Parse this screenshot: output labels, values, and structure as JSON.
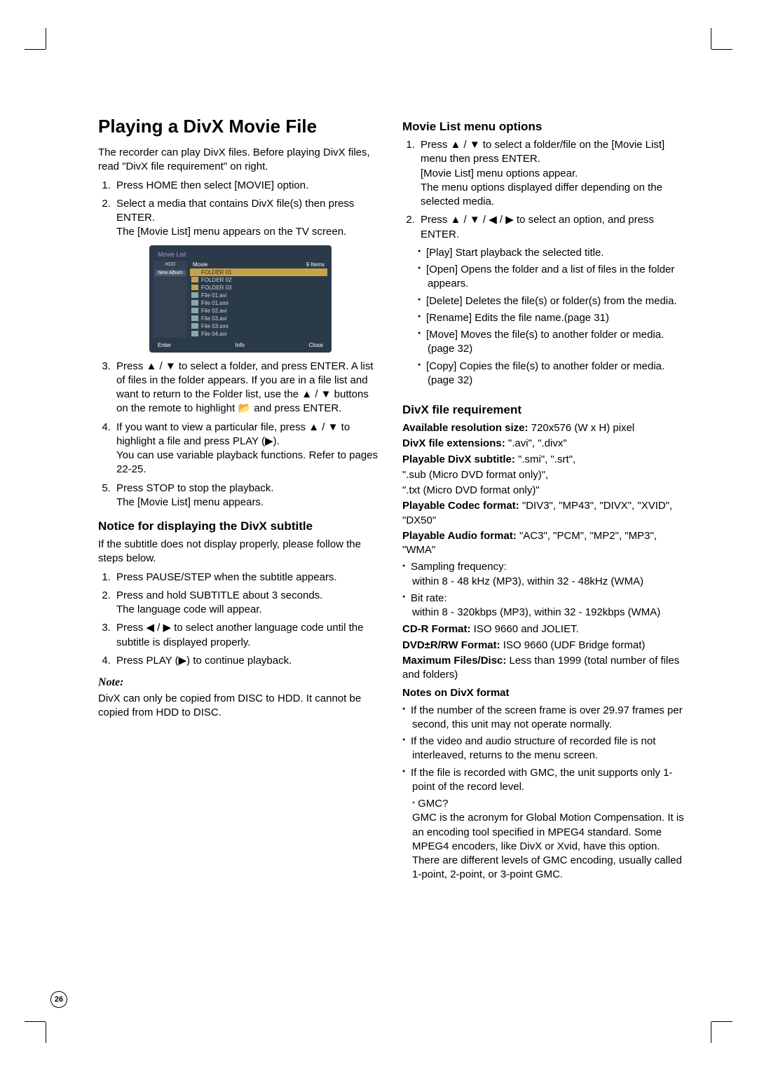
{
  "page_number": "26",
  "left": {
    "h1": "Playing a DivX Movie File",
    "intro": "The recorder can play DivX files. Before playing DivX files, read \"DivX file requirement\" on right.",
    "steps": [
      "Press HOME then select [MOVIE] option.",
      "Select a media that contains DivX file(s) then press ENTER.\nThe [Movie List] menu appears on the TV screen.",
      "Press ▲ / ▼ to select a folder, and press ENTER. A list of files in the folder appears. If you are in a file list and want to return to the Folder list, use the ▲ / ▼ buttons on the remote to highlight 📂 and press ENTER.",
      "If you want to view a particular file, press ▲ / ▼ to highlight a file and press PLAY (▶).\nYou can use variable playback functions. Refer to pages 22-25.",
      "Press STOP to stop the playback.\nThe [Movie List] menu appears."
    ],
    "h2_subtitle": "Notice for displaying the DivX subtitle",
    "subtitle_intro": "If the subtitle does not display properly, please follow the steps below.",
    "subtitle_steps": [
      "Press PAUSE/STEP when the subtitle appears.",
      "Press and hold SUBTITLE about 3 seconds.\nThe language code will appear.",
      "Press ◀ / ▶ to select another language code until the subtitle is displayed properly.",
      "Press PLAY (▶) to continue playback."
    ],
    "note_label": "Note:",
    "note_body": "DivX can only be copied from DISC to HDD. It cannot be copied from HDD to DISC."
  },
  "right": {
    "h2_options": "Movie List menu options",
    "opt_steps": [
      "Press ▲ / ▼ to select a folder/file on the [Movie List] menu then press ENTER.\n[Movie List] menu options appear.\nThe menu options displayed differ depending on the selected media.",
      "Press ▲ / ▼ / ◀ / ▶ to select an option, and press ENTER."
    ],
    "opt_bullets": [
      "[Play] Start playback the selected title.",
      "[Open] Opens the folder and a list of files in the folder appears.",
      "[Delete] Deletes the file(s) or folder(s) from the media.",
      "[Rename] Edits the file name.(page 31)",
      "[Move] Moves the file(s) to another folder or media. (page 32)",
      "[Copy] Copies the file(s) to another folder or media. (page 32)"
    ],
    "h2_req": "DivX file requirement",
    "req_lines": [
      {
        "b": "Available resolution size:",
        "t": " 720x576 (W x H) pixel"
      },
      {
        "b": "DivX file extensions:",
        "t": " \".avi\", \".divx\""
      },
      {
        "b": "Playable DivX subtitle:",
        "t": " \".smi\", \".srt\","
      },
      {
        "b": "",
        "t": "\".sub (Micro DVD format only)\","
      },
      {
        "b": "",
        "t": "\".txt (Micro DVD format only)\""
      },
      {
        "b": "Playable Codec format:",
        "t": " \"DIV3\", \"MP43\", \"DIVX\", \"XVID\", \"DX50\""
      },
      {
        "b": "Playable Audio format:",
        "t": " \"AC3\", \"PCM\", \"MP2\", \"MP3\", \"WMA\""
      }
    ],
    "req_bullets1": [
      "Sampling frequency:\nwithin 8 - 48 kHz (MP3), within 32 - 48kHz (WMA)",
      "Bit rate:\nwithin 8 - 320kbps (MP3), within 32 - 192kbps (WMA)"
    ],
    "req_lines2": [
      {
        "b": "CD-R Format:",
        "t": " ISO 9660 and JOLIET."
      },
      {
        "b": "DVD±R/RW Format:",
        "t": " ISO 9660 (UDF Bridge format)"
      },
      {
        "b": "Maximum Files/Disc:",
        "t": " Less than 1999 (total number of files and folders)"
      }
    ],
    "notes_header": "Notes on DivX format",
    "req_bullets2": [
      "If the number of the screen frame is over 29.97 frames per second, this unit may not operate normally.",
      "If the video and audio structure of recorded file is not interleaved, returns to the menu screen.",
      "If the file is recorded with GMC, the unit supports only 1-point of the record level."
    ],
    "gmc_star": "* GMC?",
    "gmc_body": "GMC is the acronym for Global Motion Compensation. It is an encoding tool specified in MPEG4 standard. Some MPEG4 encoders, like DivX or Xvid, have this option.\nThere are different levels of GMC encoding, usually called 1-point, 2-point, or 3-point GMC."
  },
  "screenshot": {
    "title": "Movie List",
    "source": "HDD",
    "header_left": "Movie",
    "header_right": "9 Items",
    "rows": [
      {
        "type": "folder",
        "name": "FOLDER 01",
        "hl": true
      },
      {
        "type": "folder",
        "name": "FOLDER 02"
      },
      {
        "type": "folder",
        "name": "FOLDER 03"
      },
      {
        "type": "file",
        "name": "File 01.avi"
      },
      {
        "type": "file",
        "name": "File 01.smi"
      },
      {
        "type": "file",
        "name": "File 02.avi"
      },
      {
        "type": "file",
        "name": "File 03.avi"
      },
      {
        "type": "file",
        "name": "File 03.smi"
      },
      {
        "type": "file",
        "name": "File 04.avi"
      }
    ],
    "new_album": "New Album",
    "footer": [
      "Enter",
      "Info",
      "Close"
    ]
  }
}
